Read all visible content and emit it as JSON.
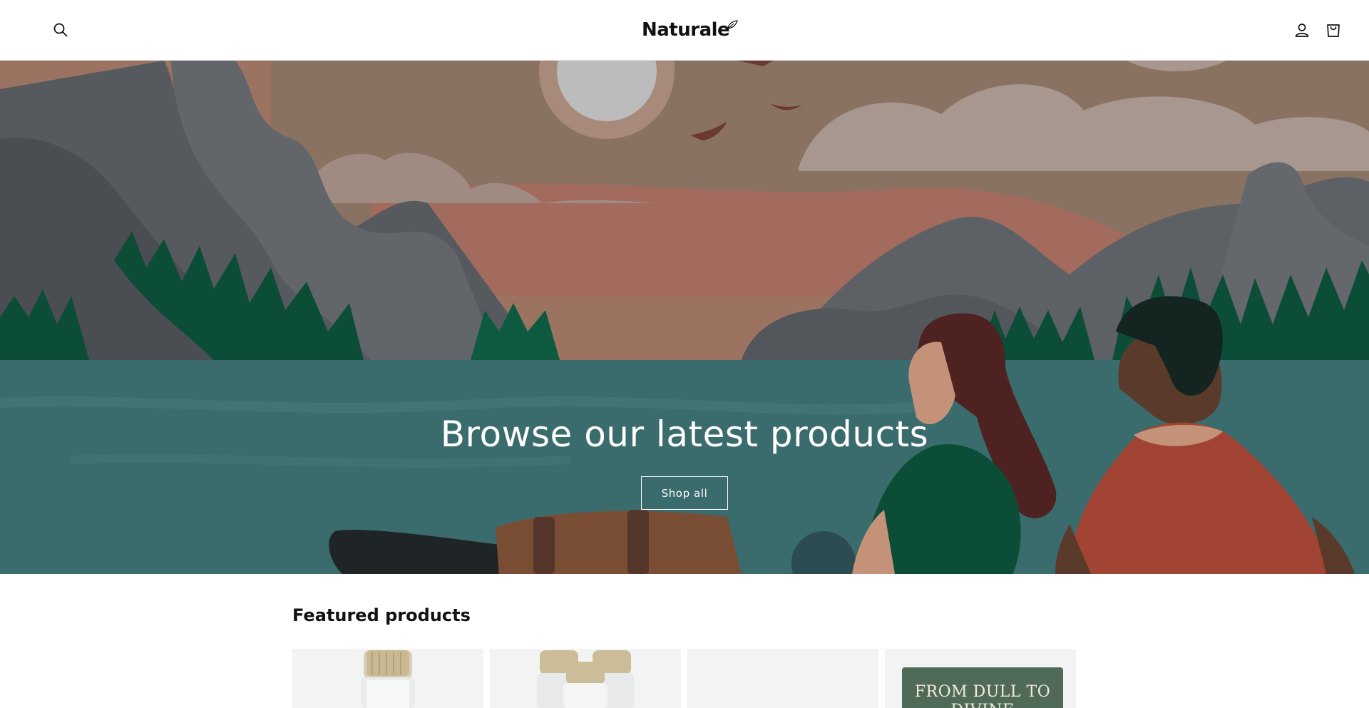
{
  "header": {
    "logo_text": "Naturale",
    "icons": [
      "search-icon",
      "account-icon",
      "cart-icon"
    ]
  },
  "hero": {
    "title": "Browse our latest products",
    "button_label": "Shop all"
  },
  "featured": {
    "title": "Featured products",
    "products": [
      {
        "image": "serum-bottle-single"
      },
      {
        "image": "serum-bottles-trio"
      },
      {
        "image": "placeholder"
      },
      {
        "image": "book-cover",
        "cover_text": "FROM DULL TO DIVINE"
      }
    ]
  },
  "colors": {
    "hero_water": "#3a6b6d",
    "hero_sky": "#a06f5c",
    "forest": "#0b4d37",
    "text": "#121212"
  }
}
